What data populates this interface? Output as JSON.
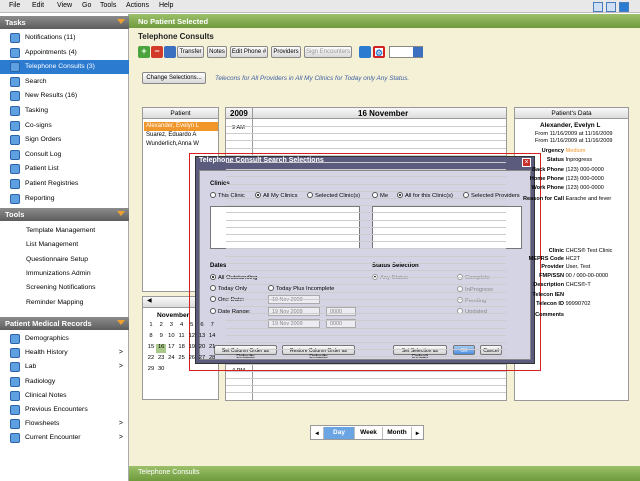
{
  "menu": [
    "File",
    "Edit",
    "View",
    "Go",
    "Tools",
    "Actions",
    "Help"
  ],
  "tasks": {
    "header": "Tasks",
    "items": [
      {
        "label": "Notifications (11)",
        "icon": "notifications-icon"
      },
      {
        "label": "Appointments (4)",
        "icon": "appointments-icon"
      },
      {
        "label": "Telephone Consults (3)",
        "icon": "telephone-icon"
      },
      {
        "label": "Search",
        "icon": "search-icon"
      },
      {
        "label": "New Results (16)",
        "icon": "results-icon"
      },
      {
        "label": "Tasking",
        "icon": "tasking-icon"
      },
      {
        "label": "Co-signs",
        "icon": "cosign-icon"
      },
      {
        "label": "Sign Orders",
        "icon": "sign-orders-icon"
      },
      {
        "label": "Consult Log",
        "icon": "consult-log-icon"
      },
      {
        "label": "Patient List",
        "icon": "patient-list-icon"
      },
      {
        "label": "Patient Registries",
        "icon": "registries-icon"
      },
      {
        "label": "Reporting",
        "icon": "reporting-icon"
      }
    ]
  },
  "tools": {
    "header": "Tools",
    "items": [
      "Template Management",
      "List Management",
      "Questionnaire Setup",
      "Immunizations Admin",
      "Screening Notifications",
      "Reminder Mapping"
    ]
  },
  "records": {
    "header": "Patient Medical Records",
    "items": [
      {
        "label": "Demographics",
        "icon": "demographics-icon",
        "arrow": ""
      },
      {
        "label": "Health History",
        "icon": "health-history-icon",
        "arrow": ">"
      },
      {
        "label": "Lab",
        "icon": "lab-icon",
        "arrow": ">"
      },
      {
        "label": "Radiology",
        "icon": "radiology-icon",
        "arrow": ""
      },
      {
        "label": "Clinical Notes",
        "icon": "clinical-notes-icon",
        "arrow": ""
      },
      {
        "label": "Previous Encounters",
        "icon": "encounters-icon",
        "arrow": ""
      },
      {
        "label": "Flowsheets",
        "icon": "flowsheets-icon",
        "arrow": ">"
      },
      {
        "label": "Current Encounter",
        "icon": "current-encounter-icon",
        "arrow": ">"
      }
    ]
  },
  "header": {
    "no_patient": "No Patient Selected",
    "title": "Telephone Consults"
  },
  "toolbar": {
    "add": "+",
    "remove": "−",
    "transfer": "Transfer",
    "notes": "Notes",
    "edit_phone": "Edit Phone #",
    "providers": "Providers",
    "sign": "Sign Encounters"
  },
  "change_selections": "Change Selections...",
  "subtitle": "Telecons for All Providers in All My Clinics for Today only Any Status.",
  "patient_col": {
    "header": "Patient",
    "rows": [
      "Alexander, Evelyn L",
      "Suarez, Eduardo A",
      "Wunderlich,Anna W"
    ]
  },
  "schedule": {
    "year": "2009",
    "date": "16 November",
    "time_am": "9 AM",
    "time_pm": "4 PM"
  },
  "patient_data": {
    "header": "Patient's Data",
    "name": "Alexander, Evelyn L",
    "from1": "From 11/16/2009 at 11/16/2009",
    "from2": "From 11/16/2009 at 11/16/2009",
    "urgency_k": "Urgency",
    "urgency_v": "Medium",
    "status_k": "Status",
    "status_v": "Inprogress",
    "phone1_k": "Back Phone",
    "phone1_v": "(123) 000-0000",
    "phone2_k": "Home Phone",
    "phone2_v": "(123) 000-0000",
    "phone3_k": "Work Phone",
    "phone3_v": "(123) 000-0000",
    "reason_k": "Reason for Call",
    "reason_v": "Earache and fever",
    "clinic_k": "Clinic",
    "clinic_v": "CHCS® Test Clinic",
    "meprs_k": "MEPRS Code",
    "meprs_v": "HC2T",
    "provider_k": "Provider",
    "provider_v": "User, Test",
    "fmp_k": "FMP/SSN",
    "fmp_v": "00 / 000-00-0000",
    "desc_k": "Description",
    "desc_v": "CHCS®-T",
    "ien_k": "Telecon IEN",
    "ien_v": "",
    "tid_k": "Telecon ID",
    "tid_v": "99990702",
    "comments_k": "Comments",
    "comments_v": ""
  },
  "calendar": {
    "month": "November",
    "rows": [
      [
        "1",
        "2",
        "3",
        "4",
        "5",
        "6",
        "7"
      ],
      [
        "8",
        "9",
        "10",
        "11",
        "12",
        "13",
        "14"
      ],
      [
        "15",
        "16",
        "17",
        "18",
        "19",
        "20",
        "21"
      ],
      [
        "22",
        "23",
        "24",
        "25",
        "26",
        "27",
        "28"
      ],
      [
        "29",
        "30",
        "",
        "",
        "",
        "",
        ""
      ]
    ],
    "today": "16"
  },
  "views": {
    "day": "Day",
    "week": "Week",
    "month": "Month"
  },
  "footer": "Telephone Consults",
  "dialog": {
    "title": "Telephone Consult Search Selections",
    "clinics_label": "Clinics",
    "clinic_opts": [
      "This Clinic",
      "All My Clinics",
      "Selected Clinic(s)"
    ],
    "provider_opts": [
      "Me",
      "All for this Clinic(s)",
      "Selected Providers"
    ],
    "dates_label": "Dates",
    "date_opts": [
      "All Outstanding",
      "Today Only",
      "Today Plus Incomplete",
      "One Date:",
      "Date Range:"
    ],
    "date1": "19 Nov 2009",
    "date2": "19 Nov 2009",
    "date3": "19 Nov 2009",
    "time1": "0000",
    "time2": "0000",
    "status_label": "Status Selection",
    "status_opts": [
      "Any Status",
      "Complete",
      "InProgress",
      "Pending",
      "Updated"
    ],
    "btn_set_col": "Set Column Order as Defaults",
    "btn_restore": "Restore Column Order as Defaults",
    "btn_set_sel": "Set Selection as Default",
    "btn_ok": "OK",
    "btn_cancel": "Cancel"
  },
  "colors": {
    "accent": "#2b7bd0",
    "green": "#7aa846",
    "orange": "#f0962b",
    "dialog": "#5b5b7e"
  }
}
